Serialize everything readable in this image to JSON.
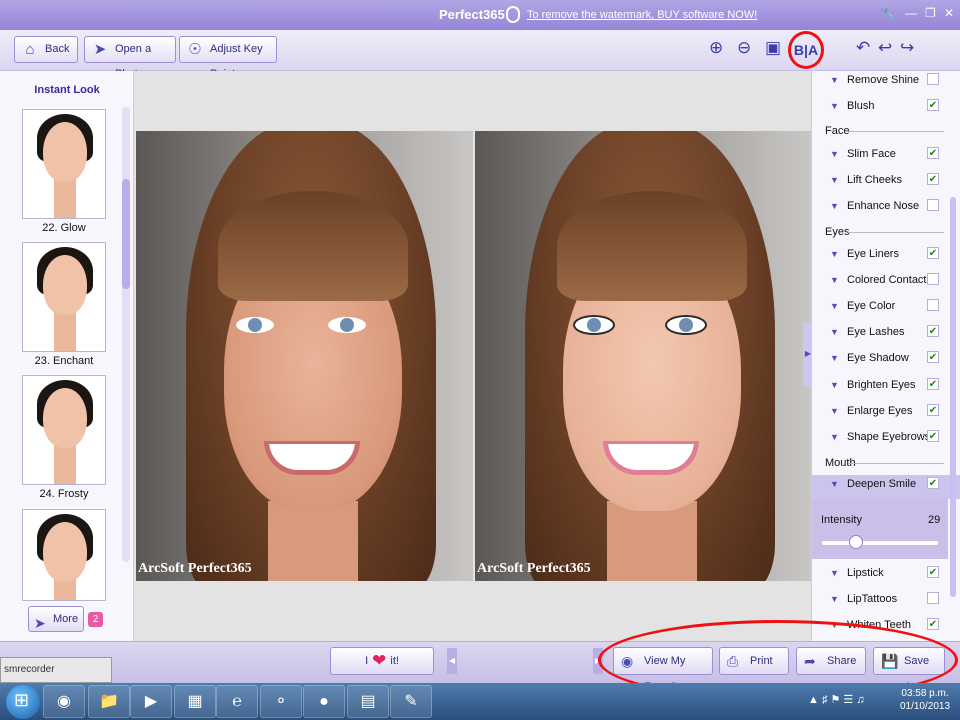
{
  "titlebar": {
    "app_name": "Perfect365",
    "promo_link": "To remove the watermark, BUY software NOW!"
  },
  "toolbar": {
    "back": "Back",
    "open_photo": "Open a Photo",
    "adjust_key_points": "Adjust Key Points",
    "before_after": "B|A"
  },
  "left_panel": {
    "title": "Instant Look",
    "looks": [
      {
        "label": "22. Glow"
      },
      {
        "label": "23. Enchant"
      },
      {
        "label": "24. Frosty"
      },
      {
        "label": ""
      }
    ],
    "more": "More",
    "more_badge": "2"
  },
  "canvas": {
    "watermark_before": "ArcSoft Perfect365",
    "watermark_after": "ArcSoft Perfect365"
  },
  "right_panel": {
    "features_top": [
      {
        "name": "Remove Shine",
        "checked": false
      },
      {
        "name": "Blush",
        "checked": true
      }
    ],
    "section_face": "Face",
    "features_face": [
      {
        "name": "Slim Face",
        "checked": true
      },
      {
        "name": "Lift Cheeks",
        "checked": true
      },
      {
        "name": "Enhance Nose",
        "checked": false
      }
    ],
    "section_eyes": "Eyes",
    "features_eyes": [
      {
        "name": "Eye Liners",
        "checked": true
      },
      {
        "name": "Colored Contacts",
        "checked": false
      },
      {
        "name": "Eye Color",
        "checked": false
      },
      {
        "name": "Eye Lashes",
        "checked": true
      },
      {
        "name": "Eye Shadow",
        "checked": true
      },
      {
        "name": "Brighten Eyes",
        "checked": true
      },
      {
        "name": "Enlarge Eyes",
        "checked": true
      },
      {
        "name": "Shape Eyebrows",
        "checked": true
      }
    ],
    "section_mouth": "Mouth",
    "features_mouth_selected": {
      "name": "Deepen Smile",
      "checked": true
    },
    "intensity_label": "Intensity",
    "intensity_value": "29",
    "intensity_fraction": 0.29,
    "features_mouth": [
      {
        "name": "Lipstick",
        "checked": true
      },
      {
        "name": "LipTattoos",
        "checked": false
      },
      {
        "name": "Whiten Teeth",
        "checked": true
      }
    ]
  },
  "bottombar": {
    "love_prefix": "I",
    "love_suffix": "it!",
    "view_favorites": "View My Favorites",
    "print": "Print",
    "share": "Share",
    "save_as": "Save As"
  },
  "recorder": "smrecorder",
  "taskbar": {
    "time": "03:58 p.m.",
    "date": "01/10/2013"
  },
  "colors": {
    "accent": "#9484d6",
    "annotation": "#ee1111",
    "checkmark": "#1a8a1a"
  }
}
